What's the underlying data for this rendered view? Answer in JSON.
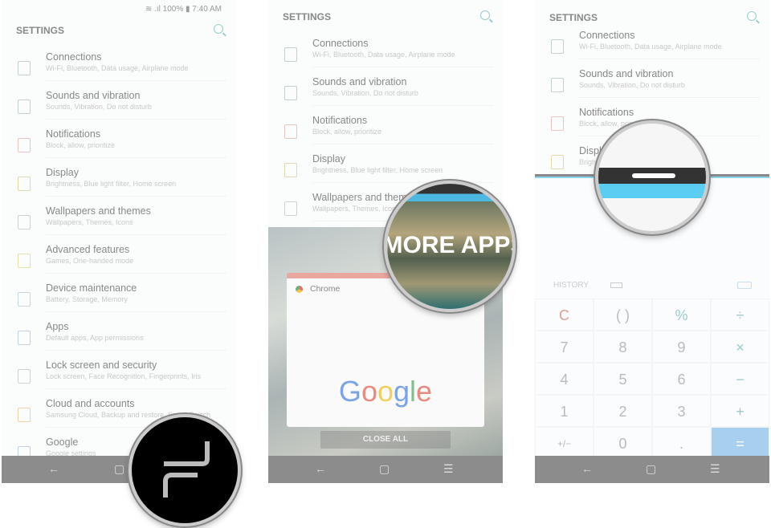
{
  "panel1": {
    "status": {
      "battery": "100%",
      "time": "7:40 AM"
    },
    "title": "SETTINGS",
    "items": [
      {
        "title": "Connections",
        "subtitle": "Wi-Fi, Bluetooth, Data usage, Airplane mode",
        "icon": "connections-icon",
        "color": "#b8c4c8"
      },
      {
        "title": "Sounds and vibration",
        "subtitle": "Sounds, Vibration, Do not disturb",
        "icon": "speaker-icon",
        "color": "#b8c4c8"
      },
      {
        "title": "Notifications",
        "subtitle": "Block, allow, prioritize",
        "icon": "notifications-icon",
        "color": "#eab7b0"
      },
      {
        "title": "Display",
        "subtitle": "Brightness, Blue light filter, Home screen",
        "icon": "display-icon",
        "color": "#d9cf9a"
      },
      {
        "title": "Wallpapers and themes",
        "subtitle": "Wallpapers, Themes, Icons",
        "icon": "brush-icon",
        "color": "#c4c8cc"
      },
      {
        "title": "Advanced features",
        "subtitle": "Games, One-handed mode",
        "icon": "advanced-features-icon",
        "color": "#e5d890"
      },
      {
        "title": "Device maintenance",
        "subtitle": "Battery, Storage, Memory",
        "icon": "device-maintenance-icon",
        "color": "#b5d0d6"
      },
      {
        "title": "Apps",
        "subtitle": "Default apps, App permissions",
        "icon": "apps-icon",
        "color": "#b5c8dc"
      },
      {
        "title": "Lock screen and security",
        "subtitle": "Lock screen, Face Recognition, Fingerprints, Iris",
        "icon": "lock-icon",
        "color": "#c4c8cc"
      },
      {
        "title": "Cloud and accounts",
        "subtitle": "Samsung Cloud, Backup and restore, Smart Switch",
        "icon": "key-icon",
        "color": "#ecc890"
      },
      {
        "title": "Google",
        "subtitle": "Google settings",
        "icon": "google-g-icon",
        "color": "#b5c8dc"
      }
    ]
  },
  "panel2": {
    "title": "SETTINGS",
    "items": [
      {
        "title": "Connections",
        "subtitle": "Wi-Fi, Bluetooth, Data usage, Airplane mode",
        "icon": "connections-icon",
        "color": "#b8c4c8"
      },
      {
        "title": "Sounds and vibration",
        "subtitle": "Sounds, Vibration, Do not disturb",
        "icon": "speaker-icon",
        "color": "#b8c4c8"
      },
      {
        "title": "Notifications",
        "subtitle": "Block, allow, prioritize",
        "icon": "notifications-icon",
        "color": "#eab7b0"
      },
      {
        "title": "Display",
        "subtitle": "Brightness, Blue light filter, Home screen",
        "icon": "display-icon",
        "color": "#d9cf9a"
      },
      {
        "title": "Wallpapers and themes",
        "subtitle": "Wallpapers, Themes, Icons",
        "icon": "brush-icon",
        "color": "#c4c8cc"
      }
    ],
    "recent_app": "Chrome",
    "google_logo": "Google",
    "close_all": "CLOSE ALL",
    "magnifier_text": "MORE APPS"
  },
  "panel3": {
    "title": "SETTINGS",
    "items": [
      {
        "title": "Connections",
        "subtitle": "Wi-Fi, Bluetooth, Data usage, Airplane mode",
        "icon": "connections-icon",
        "color": "#b8c4c8"
      },
      {
        "title": "Sounds and vibration",
        "subtitle": "Sounds, Vibration, Do not disturb",
        "icon": "speaker-icon",
        "color": "#b8c4c8"
      },
      {
        "title": "Notifications",
        "subtitle": "Block, allow, prioritize",
        "icon": "notifications-icon",
        "color": "#eab7b0"
      },
      {
        "title": "Display",
        "subtitle": "Brightness, Blue light filter, Home screen",
        "icon": "display-icon",
        "color": "#d9cf9a"
      }
    ],
    "calculator": {
      "history": "HISTORY",
      "keys": [
        "C",
        "( )",
        "%",
        "÷",
        "7",
        "8",
        "9",
        "×",
        "4",
        "5",
        "6",
        "−",
        "1",
        "2",
        "3",
        "+",
        "+/−",
        "0",
        ".",
        "="
      ],
      "accent": "#a8d0ee",
      "clear_color": "#e0a090",
      "operator_color": "#9cc"
    }
  },
  "nav": {
    "back": "←",
    "home": "▢",
    "recents": "☰"
  }
}
